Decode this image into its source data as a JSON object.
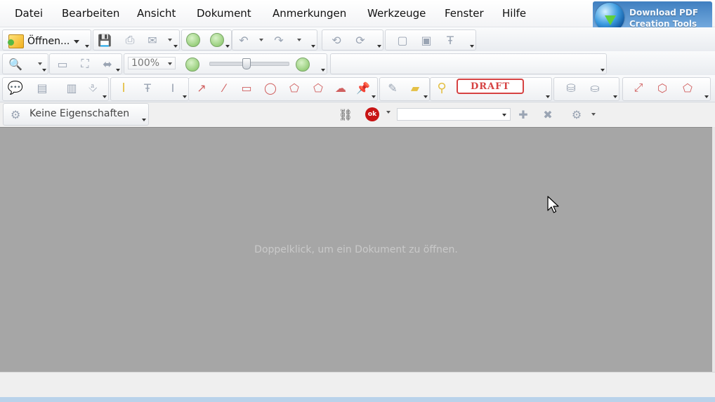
{
  "menubar": {
    "items": [
      "Datei",
      "Bearbeiten",
      "Ansicht",
      "Dokument",
      "Anmerkungen",
      "Werkzeuge",
      "Fenster",
      "Hilfe"
    ]
  },
  "promo": {
    "line1": "Download PDF",
    "line2": "Creation Tools"
  },
  "toolbar1": {
    "open_label": "Öffnen..."
  },
  "toolbar2": {
    "zoom_value": "100%",
    "stamp_icon_text": "ok"
  },
  "toolbar3": {
    "stamp_label": "DRAFT"
  },
  "properties": {
    "label": "Keine Eigenschaften"
  },
  "workspace": {
    "hint": "Doppelklick, um ein Dokument zu öffnen."
  }
}
